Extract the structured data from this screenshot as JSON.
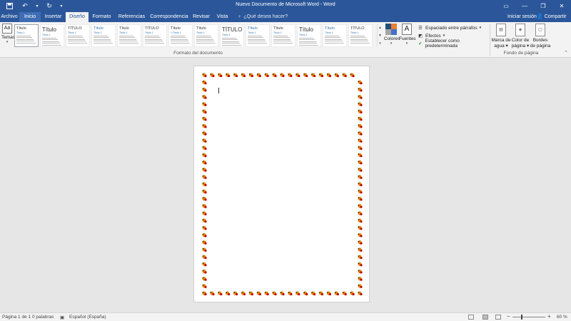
{
  "window": {
    "title": "Nuevo Documento de Microsoft Word - Word",
    "qat": {
      "save_icon": "save-icon",
      "undo_icon": "undo-icon",
      "redo_icon": "redo-icon",
      "customize_icon": "chevron-down-icon"
    }
  },
  "tabs": [
    "Archivo",
    "Inicio",
    "Insertar",
    "Diseño",
    "Formato",
    "Referencias",
    "Correspondencia",
    "Revisar",
    "Vista"
  ],
  "active_tab": "Diseño",
  "tell_me": "¿Qué desea hacer?",
  "sign_in": "Iniciar sesión",
  "share": "Compartir",
  "ribbon": {
    "themes_label": "Temas",
    "themes_icon_text": "Aa",
    "document_format_label": "Formato del documento",
    "gallery": [
      {
        "title": "Título",
        "sub": "Título 1"
      },
      {
        "title": "Título",
        "sub": "Título 1"
      },
      {
        "title": "TÍTULO",
        "sub": "Título 1"
      },
      {
        "title": "Título",
        "sub": "Título 1"
      },
      {
        "title": "Título",
        "sub": "Título 1"
      },
      {
        "title": "TÍTULO",
        "sub": "Título 1"
      },
      {
        "title": "Título",
        "sub": "1 Título 1"
      },
      {
        "title": "Título",
        "sub": "Título 1"
      },
      {
        "title": "TÍTULO",
        "sub": "Título 1"
      },
      {
        "title": "Título",
        "sub": "Título 1"
      },
      {
        "title": "Título",
        "sub": "Título 1"
      },
      {
        "title": "Título",
        "sub": "Título 1"
      },
      {
        "title": "Título",
        "sub": "Título 1"
      },
      {
        "title": "TÍTULO",
        "sub": "Título 1"
      }
    ],
    "colors_label": "Colores",
    "fonts_label": "Fuentes",
    "fonts_icon_text": "A",
    "paragraph_spacing": "Espaciado entre párrafos",
    "effects": "Efectos",
    "set_default": "Establecer como predeterminada",
    "page_background_label": "Fondo de página",
    "watermark": [
      "Marca de",
      "agua"
    ],
    "page_color": [
      "Color de",
      "página"
    ],
    "page_borders": [
      "Bordes",
      "de página"
    ],
    "colors": [
      "#1f4e79",
      "#ed7d31",
      "#a5a5a5",
      "#4472c4"
    ]
  },
  "status": {
    "page": "Página 1 de 1",
    "words": "0 palabras",
    "language": "Español (España)",
    "zoom": "60 %",
    "zoom_minus": "−",
    "zoom_plus": "+"
  },
  "theme_colors": {
    "word_blue": "#2b579a",
    "border_orange": "#e68a00",
    "border_red": "#c00000"
  }
}
